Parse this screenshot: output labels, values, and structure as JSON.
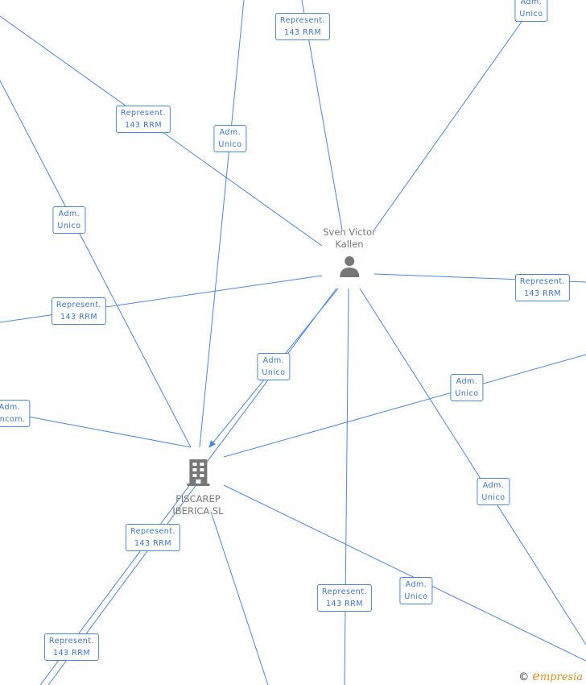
{
  "nodes": {
    "person": {
      "name_line1": "Sven Victor",
      "name_line2": "Kallen",
      "icon": "person-icon"
    },
    "company": {
      "name_line1": "FISCAREP",
      "name_line2": "IBERICA SL",
      "icon": "building-icon"
    }
  },
  "edge_labels": [
    {
      "line1": "Represent.",
      "line2": "143 RRM"
    },
    {
      "line1": "Adm.",
      "line2": "Unico"
    },
    {
      "line1": "Represent.",
      "line2": "143 RRM"
    },
    {
      "line1": "Adm.",
      "line2": "Unico"
    },
    {
      "line1": "Adm.",
      "line2": "Unico"
    },
    {
      "line1": "Represent.",
      "line2": "143 RRM"
    },
    {
      "line1": "Represent.",
      "line2": "143 RRM"
    },
    {
      "line1": "Adm.",
      "line2": "Unico"
    },
    {
      "line1": "Adm.",
      "line2": "Uncom."
    },
    {
      "line1": "Adm.",
      "line2": "Unico"
    },
    {
      "line1": "Represent.",
      "line2": "143 RRM"
    },
    {
      "line1": "Represent.",
      "line2": "143 RRM"
    },
    {
      "line1": "Represent.",
      "line2": "143 RRM"
    },
    {
      "line1": "Adm.",
      "line2": "Unico"
    },
    {
      "line1": "Adm.",
      "line2": "Unico"
    }
  ],
  "colors": {
    "edge": "#4a86e0",
    "label_text": "#3b74d0",
    "node_icon": "#777777"
  },
  "brand": {
    "copyright": "©",
    "initial": "e",
    "rest": "mpresia"
  }
}
